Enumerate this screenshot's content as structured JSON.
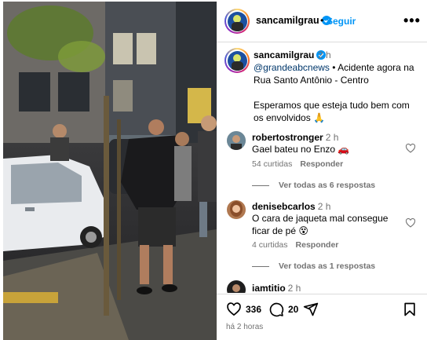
{
  "header": {
    "username": "sancamilgrau",
    "separator": "•",
    "follow_label": "Seguir",
    "more_label": "•••"
  },
  "caption": {
    "username": "sancamilgrau",
    "time": "2 h",
    "mention": "@grandeabcnews",
    "text_line1": " • Acidente agora na Rua Santo Antônio - Centro",
    "text_line2": "Esperamos que esteja tudo bem com os envolvidos 🙏"
  },
  "comments": [
    {
      "username": "robertostronger",
      "time": "2 h",
      "text": "Gael bateu no Enzo 🚗",
      "likes": "54 curtidas",
      "reply_label": "Responder",
      "view_replies": "Ver todas as 6 respostas"
    },
    {
      "username": "denisebcarlos",
      "time": "2 h",
      "text": "O cara de jaqueta mal consegue ficar de pé 😵",
      "likes": "4 curtidas",
      "reply_label": "Responder",
      "view_replies": "Ver todas as 1 respostas"
    },
    {
      "username": "iamtitio",
      "time": "2 h"
    }
  ],
  "actions": {
    "likes_count": "336",
    "comments_count": "20",
    "time_ago": "há 2 horas"
  },
  "colors": {
    "accent": "#0095f6",
    "muted": "#737373",
    "verified": "#0095f6",
    "border": "#dbdbdb"
  },
  "icons": [
    "verified-icon",
    "more-icon",
    "heart-icon",
    "comment-icon",
    "share-icon",
    "save-icon"
  ]
}
